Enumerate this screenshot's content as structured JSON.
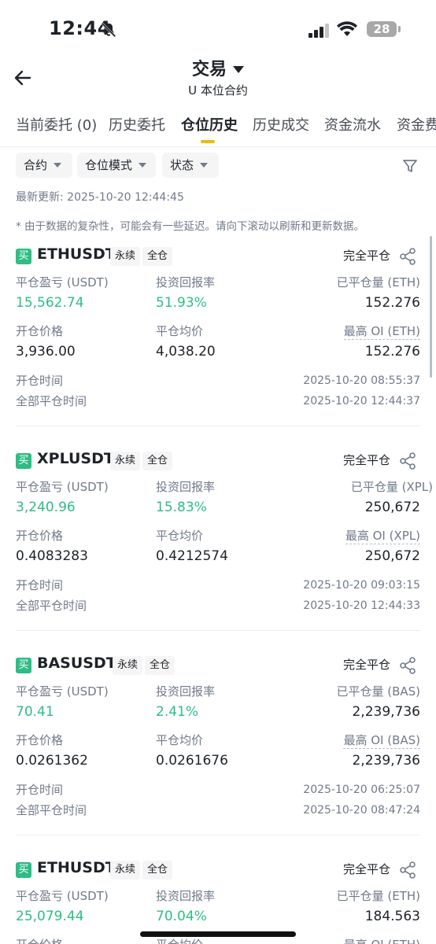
{
  "status_bar": {
    "time": "12:44",
    "battery": "28"
  },
  "header": {
    "title": "交易",
    "subtitle": "U 本位合约"
  },
  "tabs": [
    {
      "label": "当前委托 (0)",
      "active": false
    },
    {
      "label": "历史委托",
      "active": false
    },
    {
      "label": "仓位历史",
      "active": true
    },
    {
      "label": "历史成交",
      "active": false
    },
    {
      "label": "资金流水",
      "active": false
    },
    {
      "label": "资金费",
      "active": false
    }
  ],
  "filters": [
    {
      "label": "合约"
    },
    {
      "label": "仓位模式"
    },
    {
      "label": "状态"
    }
  ],
  "last_update": "最新更新: 2025-10-20 12:44:45",
  "note": "* 由于数据的复杂性，可能会有一些延迟。请向下滚动以刷新和更新数据。",
  "labels": {
    "pnl": "平仓盈亏 (USDT)",
    "roi": "投资回报率",
    "open_price": "开仓价格",
    "avg_close": "平仓均价",
    "open_time": "开仓时间",
    "close_time": "全部平仓时间",
    "close_all": "完全平仓",
    "perpetual": "永续",
    "cross": "全仓",
    "buy": "买"
  },
  "positions": [
    {
      "symbol": "ETHUSDT",
      "pnl": "15,562.74",
      "roi": "51.93%",
      "closed_vol_label": "已平仓量 (ETH)",
      "closed_vol": "152.276",
      "open_price": "3,936.00",
      "avg_close": "4,038.20",
      "max_oi_label": "最高 OI (ETH)",
      "max_oi": "152.276",
      "open_time": "2025-10-20 08:55:37",
      "close_time": "2025-10-20 12:44:37"
    },
    {
      "symbol": "XPLUSDT",
      "pnl": "3,240.96",
      "roi": "15.83%",
      "closed_vol_label": "已平仓量 (XPL)",
      "closed_vol": "250,672",
      "open_price": "0.4083283",
      "avg_close": "0.4212574",
      "max_oi_label": "最高 OI (XPL)",
      "max_oi": "250,672",
      "open_time": "2025-10-20 09:03:15",
      "close_time": "2025-10-20 12:44:33"
    },
    {
      "symbol": "BASUSDT",
      "pnl": "70.41",
      "roi": "2.41%",
      "closed_vol_label": "已平仓量 (BAS)",
      "closed_vol": "2,239,736",
      "open_price": "0.0261362",
      "avg_close": "0.0261676",
      "max_oi_label": "最高 OI (BAS)",
      "max_oi": "2,239,736",
      "open_time": "2025-10-20 06:25:07",
      "close_time": "2025-10-20 08:47:24"
    },
    {
      "symbol": "ETHUSDT",
      "pnl": "25,079.44",
      "roi": "70.04%",
      "closed_vol_label": "已平仓量 (ETH)",
      "closed_vol": "184.563",
      "open_price": "",
      "avg_close": "",
      "max_oi_label": "最高 OI (ETH)",
      "max_oi": "",
      "open_time": "",
      "close_time": ""
    }
  ],
  "colors": {
    "accent": "#f0b90b",
    "buy": "#2ebd85",
    "text": "#1e2329",
    "muted": "#707a8a"
  }
}
